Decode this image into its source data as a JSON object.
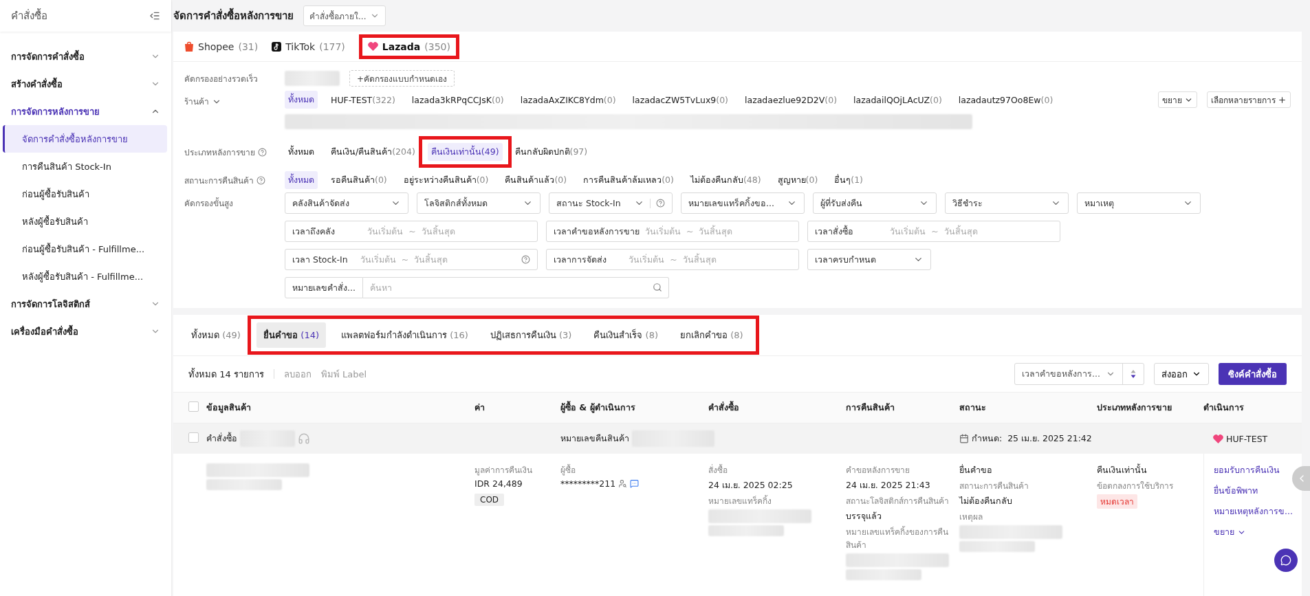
{
  "sidebar": {
    "title": "คำสั่งซื้อ",
    "groups": [
      {
        "label": "การจัดการคำสั่งซื้อ",
        "expanded": false
      },
      {
        "label": "สร้างคำสั่งซื้อ",
        "expanded": false
      },
      {
        "label": "การจัดการหลังการขาย",
        "expanded": true,
        "children": [
          {
            "label": "จัดการคำสั่งซื้อหลังการขาย",
            "selected": true
          },
          {
            "label": "การคืนสินค้า Stock-In",
            "selected": false
          },
          {
            "label": "ก่อนผู้ซื้อรับสินค้า",
            "selected": false
          },
          {
            "label": "หลังผู้ซื้อรับสินค้า",
            "selected": false
          },
          {
            "label": "ก่อนผู้ซื้อรับสินค้า - Fulfillme...",
            "selected": false
          },
          {
            "label": "หลังผู้ซื้อรับสินค้า - Fulfillme...",
            "selected": false
          }
        ]
      },
      {
        "label": "การจัดการโลจิสติกส์",
        "expanded": false
      },
      {
        "label": "เครื่องมือคำสั่งซื้อ",
        "expanded": false
      }
    ]
  },
  "header": {
    "title": "จัดการคำสั่งซื้อหลังการขาย",
    "select": "คำสั่งซื้อภายใ..."
  },
  "platform_tabs": [
    {
      "kind": "bag",
      "label": "Shopee",
      "count": "(31)",
      "selected": false,
      "outlined": false
    },
    {
      "kind": "note",
      "label": "TikTok",
      "count": "(177)",
      "selected": false,
      "outlined": false
    },
    {
      "kind": "heart",
      "label": "Lazada",
      "count": "(350)",
      "selected": true,
      "outlined": true
    }
  ],
  "quick_filter": {
    "label": "คัดกรองอย่างรวดเร็ว",
    "add": "+คัดกรองแบบกำหนดเอง"
  },
  "store_filter": {
    "label": "ร้านค้า",
    "items": [
      {
        "label": "ทั้งหมด",
        "selected": true
      },
      {
        "label": "HUF-TEST",
        "count": "(322)",
        "selected": false
      },
      {
        "label": "lazada3kRPqCCJsK",
        "count": "(0)",
        "selected": false
      },
      {
        "label": "lazadaAxZIKC8Ydm",
        "count": "(0)",
        "selected": false
      },
      {
        "label": "lazadacZW5TvLux9",
        "count": "(0)",
        "selected": false
      },
      {
        "label": "lazadaezlue92D2V",
        "count": "(0)",
        "selected": false
      },
      {
        "label": "lazadailQOjLAcUZ",
        "count": "(0)",
        "selected": false
      },
      {
        "label": "lazadautz97Oo8Ew",
        "count": "(0)",
        "selected": false
      }
    ],
    "expand": "ขยาย",
    "multi": "เลือกหลายรายการ"
  },
  "type_filter": {
    "label": "ประเภทหลังการขาย",
    "items": [
      {
        "label": "ทั้งหมด",
        "selected": false,
        "outlined": false
      },
      {
        "label": "คืนเงิน/คืนสินค้า",
        "count": "(204)",
        "selected": false,
        "outlined": false
      },
      {
        "label": "คืนเงินเท่านั้น",
        "count": "(49)",
        "selected": true,
        "outlined": true
      },
      {
        "label": "คืนกลับผิดปกติ",
        "count": "(97)",
        "selected": false,
        "outlined": false
      }
    ]
  },
  "return_status_filter": {
    "label": "สถานะการคืนสินค้า",
    "items": [
      {
        "label": "ทั้งหมด",
        "selected": true
      },
      {
        "label": "รอคืนสินค้า",
        "count": "(0)",
        "selected": false
      },
      {
        "label": "อยู่ระหว่างคืนสินค้า",
        "count": "(0)",
        "selected": false
      },
      {
        "label": "คืนสินค้าแล้ว",
        "count": "(0)",
        "selected": false
      },
      {
        "label": "การคืนสินค้าล้มเหลว",
        "count": "(0)",
        "selected": false
      },
      {
        "label": "ไม่ต้องคืนกลับ",
        "count": "(48)",
        "selected": false
      },
      {
        "label": "สูญหาย",
        "count": "(0)",
        "selected": false
      },
      {
        "label": "อื่นๆ",
        "count": "(1)",
        "selected": false
      }
    ]
  },
  "advanced_filter": {
    "label": "คัดกรองขั้นสูง",
    "rows": [
      {
        "fields": [
          {
            "kind": "select",
            "label": "คลังสินค้าจัดส่ง"
          },
          {
            "kind": "select",
            "label": "โลจิสติกส์ทั้งหมด"
          },
          {
            "kind": "select_help",
            "label": "สถานะ Stock-In"
          },
          {
            "kind": "select",
            "label": "หมายเลขแทร็คกิ้งขอ..."
          },
          {
            "kind": "select",
            "label": "ผู้ที่รับส่งคืน"
          },
          {
            "kind": "select",
            "label": "วิธีชำระ"
          },
          {
            "kind": "select",
            "label": "หมาเหตุ"
          }
        ]
      },
      {
        "fields": [
          {
            "kind": "date",
            "label": "เวลาถึงคลัง",
            "start": "วันเริ่มต้น",
            "separator": "~",
            "end": "วันสิ้นสุด",
            "help": false
          },
          {
            "kind": "date",
            "label": "เวลาคำขอหลังการขาย",
            "start": "วันเริ่มต้น",
            "separator": "~",
            "end": "วันสิ้นสุด",
            "help": false
          },
          {
            "kind": "date",
            "label": "เวลาสั่งซื้อ",
            "start": "วันเริ่มต้น",
            "separator": "~",
            "end": "วันสิ้นสุด",
            "help": false
          }
        ]
      },
      {
        "fields": [
          {
            "kind": "date",
            "label": "เวลา Stock-In",
            "start": "วันเริ่มต้น",
            "separator": "~",
            "end": "วันสิ้นสุด",
            "help": true
          },
          {
            "kind": "date",
            "label": "เวลาการจัดส่ง",
            "start": "วันเริ่มต้น",
            "separator": "~",
            "end": "วันสิ้นสุด",
            "help": false
          },
          {
            "kind": "select",
            "label": "เวลาครบกำหนด"
          }
        ]
      },
      {
        "fields": [
          {
            "kind": "search",
            "label": "หมายเลขคำสั่ง...",
            "placeholder": "ค้นหา"
          }
        ]
      }
    ]
  },
  "status_tabs": [
    {
      "label": "ทั้งหมด",
      "count": "(49)",
      "selected": false,
      "outlined": false
    },
    {
      "label": "ยื่นคำขอ",
      "count": "(14)",
      "selected": true,
      "outlined": true
    },
    {
      "label": "แพลตฟอร์มกำลังดำเนินการ",
      "count": "(16)",
      "selected": false,
      "outlined": true
    },
    {
      "label": "ปฏิเสธการคืนเงิน",
      "count": "(3)",
      "selected": false,
      "outlined": true
    },
    {
      "label": "คืนเงินสำเร็จ",
      "count": "(8)",
      "selected": false,
      "outlined": true
    },
    {
      "label": "ยกเลิกคำขอ",
      "count": "(8)",
      "selected": false,
      "outlined": true
    }
  ],
  "toolbar": {
    "total": "ทั้งหมด 14 รายการ",
    "actions": [
      "ลบออก",
      "พิมพ์ Label"
    ],
    "sort": "เวลาคำขอหลังการ...",
    "export": "ส่งออก",
    "sync": "ซิงค์คำสั่งซื้อ"
  },
  "table": {
    "columns": [
      "ข้อมูลสินค้า",
      "ค่า",
      "ผู้ซื้อ & ผู้ดำเนินการ",
      "คำสั่งซื้อ",
      "การคืนสินค้า",
      "สถานะ",
      "ประเภทหลังการขาย",
      "ดำเนินการ"
    ],
    "select_all_checked": false,
    "order": {
      "checked": false,
      "order_label": "คำสั่งซื้อ",
      "return_label": "หมายเลขคืนสินค้า",
      "deadline": "กำหนด:  25 เม.ย. 2025 21:42",
      "store": "HUF-TEST"
    },
    "detail": [
      [
        {
          "kind": "redacted"
        }
      ],
      [
        {
          "kind": "label",
          "text": "มูลค่าการคืนเงิน"
        },
        {
          "kind": "value",
          "text": "IDR 24,489"
        },
        {
          "kind": "tag",
          "text": "COD"
        }
      ],
      [
        {
          "kind": "label",
          "text": "ผู้ซื้อ"
        },
        {
          "kind": "buyer",
          "text": "*********211"
        }
      ],
      [
        {
          "kind": "label",
          "text": "สั่งซื้อ"
        },
        {
          "kind": "value",
          "text": "24 เม.ย. 2025 02:25"
        },
        {
          "kind": "label",
          "text": "หมายเลขแทร็คกิ้ง"
        },
        {
          "kind": "redacted"
        }
      ],
      [
        {
          "kind": "label",
          "text": "คำขอหลังการขาย"
        },
        {
          "kind": "value",
          "text": "24 เม.ย. 2025 21:43"
        },
        {
          "kind": "label",
          "text": "สถานะโลจิสติกส์การคืนสินค้า"
        },
        {
          "kind": "value",
          "text": "บรรจุแล้ว"
        },
        {
          "kind": "label",
          "text": "หมายเลขแทร็คกิ้งของการคืนสินค้า"
        },
        {
          "kind": "redacted"
        }
      ],
      [
        {
          "kind": "value",
          "text": "ยื่นคำขอ"
        },
        {
          "kind": "label",
          "text": "สถานะการคืนสินค้า"
        },
        {
          "kind": "value",
          "text": "ไม่ต้องคืนกลับ"
        },
        {
          "kind": "label",
          "text": "เหตุผล"
        },
        {
          "kind": "redacted"
        }
      ],
      [
        {
          "kind": "value",
          "text": "คืนเงินเท่านั้น"
        },
        {
          "kind": "label",
          "text": "ข้อตกลงการใช้บริการ"
        },
        {
          "kind": "alert",
          "text": "หมดเวลา"
        }
      ],
      [
        {
          "kind": "link",
          "text": "ยอมรับการคืนเงิน"
        },
        {
          "kind": "link",
          "text": "ยื่นข้อพิพาท"
        },
        {
          "kind": "link",
          "text": "หมายเหตุหลังการข..."
        },
        {
          "kind": "more",
          "text": "ขยาย"
        }
      ]
    ]
  }
}
